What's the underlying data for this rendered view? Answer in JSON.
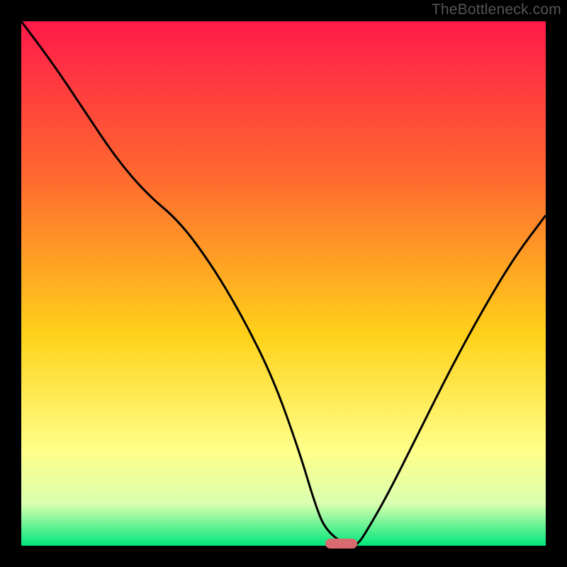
{
  "attribution": "TheBottleneck.com",
  "colors": {
    "bg": "#000000",
    "gradient_top": "#ff1a4a",
    "gradient_mid1": "#ff6a2f",
    "gradient_mid2": "#ffd21a",
    "gradient_mid3": "#ffff8a",
    "gradient_mid4": "#d9ffb0",
    "gradient_bottom": "#00e67a",
    "curve_stroke": "#000000",
    "marker": "#d96a6f"
  },
  "chart_data": {
    "type": "line",
    "title": "",
    "xlabel": "",
    "ylabel": "",
    "xlim": [
      0,
      100
    ],
    "ylim": [
      0,
      100
    ],
    "series": [
      {
        "name": "bottleneck-curve",
        "x": [
          0,
          6,
          12,
          18,
          24,
          30,
          36,
          42,
          48,
          53,
          56,
          58,
          62,
          64,
          66,
          70,
          76,
          82,
          88,
          94,
          100
        ],
        "values": [
          100,
          92,
          83,
          74,
          67,
          62,
          54,
          44,
          32,
          18,
          8,
          3,
          0,
          0,
          3,
          10,
          22,
          34,
          45,
          55,
          63
        ]
      }
    ],
    "annotations": [
      {
        "name": "optimal-marker",
        "x_start": 58,
        "x_end": 64,
        "y": 0
      }
    ],
    "grid": false,
    "legend": false
  }
}
